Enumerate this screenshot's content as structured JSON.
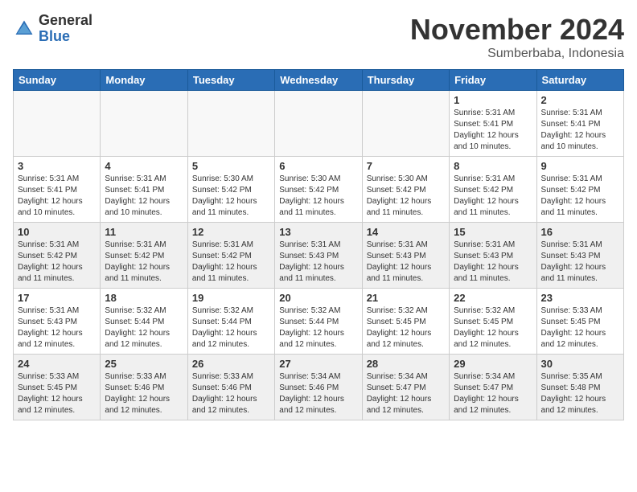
{
  "header": {
    "logo_general": "General",
    "logo_blue": "Blue",
    "month": "November 2024",
    "location": "Sumberbaba, Indonesia"
  },
  "weekdays": [
    "Sunday",
    "Monday",
    "Tuesday",
    "Wednesday",
    "Thursday",
    "Friday",
    "Saturday"
  ],
  "weeks": [
    [
      {
        "day": "",
        "info": ""
      },
      {
        "day": "",
        "info": ""
      },
      {
        "day": "",
        "info": ""
      },
      {
        "day": "",
        "info": ""
      },
      {
        "day": "",
        "info": ""
      },
      {
        "day": "1",
        "info": "Sunrise: 5:31 AM\nSunset: 5:41 PM\nDaylight: 12 hours\nand 10 minutes."
      },
      {
        "day": "2",
        "info": "Sunrise: 5:31 AM\nSunset: 5:41 PM\nDaylight: 12 hours\nand 10 minutes."
      }
    ],
    [
      {
        "day": "3",
        "info": "Sunrise: 5:31 AM\nSunset: 5:41 PM\nDaylight: 12 hours\nand 10 minutes."
      },
      {
        "day": "4",
        "info": "Sunrise: 5:31 AM\nSunset: 5:41 PM\nDaylight: 12 hours\nand 10 minutes."
      },
      {
        "day": "5",
        "info": "Sunrise: 5:30 AM\nSunset: 5:42 PM\nDaylight: 12 hours\nand 11 minutes."
      },
      {
        "day": "6",
        "info": "Sunrise: 5:30 AM\nSunset: 5:42 PM\nDaylight: 12 hours\nand 11 minutes."
      },
      {
        "day": "7",
        "info": "Sunrise: 5:30 AM\nSunset: 5:42 PM\nDaylight: 12 hours\nand 11 minutes."
      },
      {
        "day": "8",
        "info": "Sunrise: 5:31 AM\nSunset: 5:42 PM\nDaylight: 12 hours\nand 11 minutes."
      },
      {
        "day": "9",
        "info": "Sunrise: 5:31 AM\nSunset: 5:42 PM\nDaylight: 12 hours\nand 11 minutes."
      }
    ],
    [
      {
        "day": "10",
        "info": "Sunrise: 5:31 AM\nSunset: 5:42 PM\nDaylight: 12 hours\nand 11 minutes."
      },
      {
        "day": "11",
        "info": "Sunrise: 5:31 AM\nSunset: 5:42 PM\nDaylight: 12 hours\nand 11 minutes."
      },
      {
        "day": "12",
        "info": "Sunrise: 5:31 AM\nSunset: 5:42 PM\nDaylight: 12 hours\nand 11 minutes."
      },
      {
        "day": "13",
        "info": "Sunrise: 5:31 AM\nSunset: 5:43 PM\nDaylight: 12 hours\nand 11 minutes."
      },
      {
        "day": "14",
        "info": "Sunrise: 5:31 AM\nSunset: 5:43 PM\nDaylight: 12 hours\nand 11 minutes."
      },
      {
        "day": "15",
        "info": "Sunrise: 5:31 AM\nSunset: 5:43 PM\nDaylight: 12 hours\nand 11 minutes."
      },
      {
        "day": "16",
        "info": "Sunrise: 5:31 AM\nSunset: 5:43 PM\nDaylight: 12 hours\nand 11 minutes."
      }
    ],
    [
      {
        "day": "17",
        "info": "Sunrise: 5:31 AM\nSunset: 5:43 PM\nDaylight: 12 hours\nand 12 minutes."
      },
      {
        "day": "18",
        "info": "Sunrise: 5:32 AM\nSunset: 5:44 PM\nDaylight: 12 hours\nand 12 minutes."
      },
      {
        "day": "19",
        "info": "Sunrise: 5:32 AM\nSunset: 5:44 PM\nDaylight: 12 hours\nand 12 minutes."
      },
      {
        "day": "20",
        "info": "Sunrise: 5:32 AM\nSunset: 5:44 PM\nDaylight: 12 hours\nand 12 minutes."
      },
      {
        "day": "21",
        "info": "Sunrise: 5:32 AM\nSunset: 5:45 PM\nDaylight: 12 hours\nand 12 minutes."
      },
      {
        "day": "22",
        "info": "Sunrise: 5:32 AM\nSunset: 5:45 PM\nDaylight: 12 hours\nand 12 minutes."
      },
      {
        "day": "23",
        "info": "Sunrise: 5:33 AM\nSunset: 5:45 PM\nDaylight: 12 hours\nand 12 minutes."
      }
    ],
    [
      {
        "day": "24",
        "info": "Sunrise: 5:33 AM\nSunset: 5:45 PM\nDaylight: 12 hours\nand 12 minutes."
      },
      {
        "day": "25",
        "info": "Sunrise: 5:33 AM\nSunset: 5:46 PM\nDaylight: 12 hours\nand 12 minutes."
      },
      {
        "day": "26",
        "info": "Sunrise: 5:33 AM\nSunset: 5:46 PM\nDaylight: 12 hours\nand 12 minutes."
      },
      {
        "day": "27",
        "info": "Sunrise: 5:34 AM\nSunset: 5:46 PM\nDaylight: 12 hours\nand 12 minutes."
      },
      {
        "day": "28",
        "info": "Sunrise: 5:34 AM\nSunset: 5:47 PM\nDaylight: 12 hours\nand 12 minutes."
      },
      {
        "day": "29",
        "info": "Sunrise: 5:34 AM\nSunset: 5:47 PM\nDaylight: 12 hours\nand 12 minutes."
      },
      {
        "day": "30",
        "info": "Sunrise: 5:35 AM\nSunset: 5:48 PM\nDaylight: 12 hours\nand 12 minutes."
      }
    ]
  ]
}
